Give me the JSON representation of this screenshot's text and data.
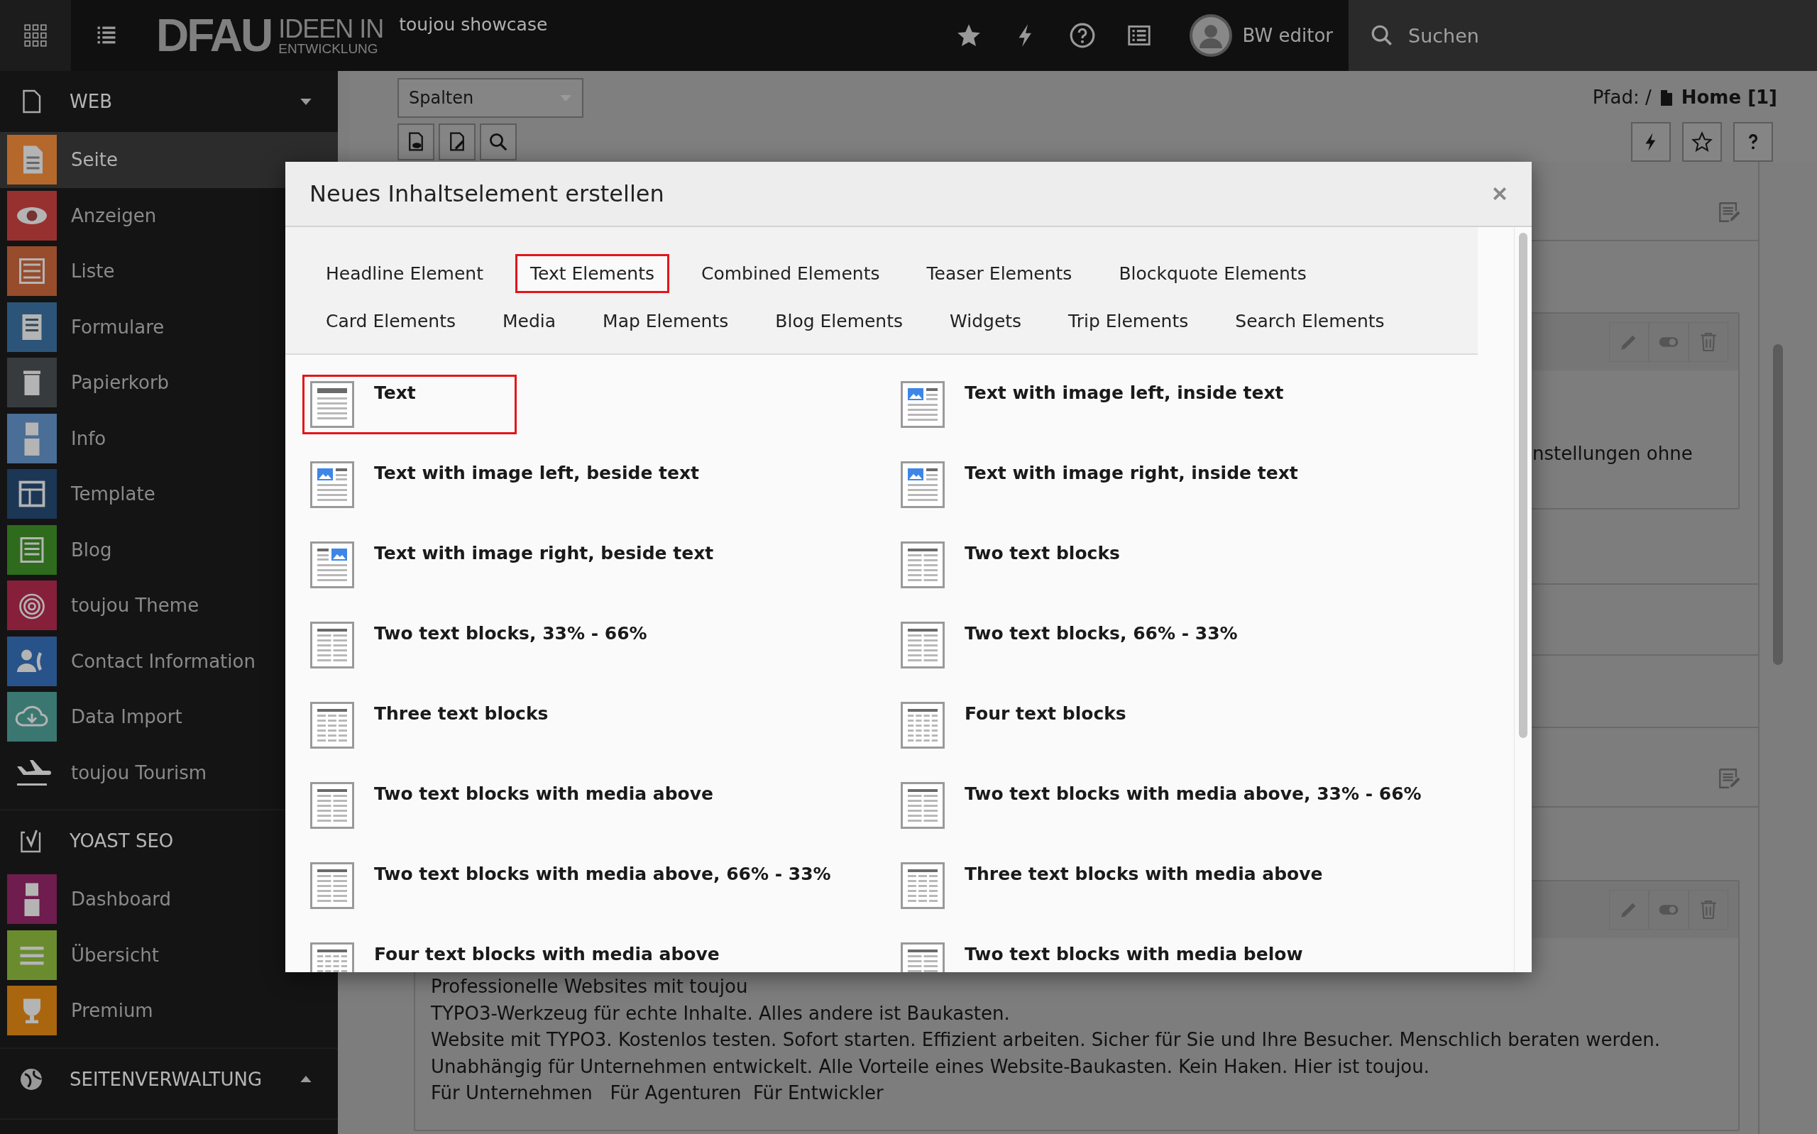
{
  "topbar": {
    "logo": {
      "mark": "DFAU",
      "line1": "IDEEN IN",
      "line2": "ENTWICKLUNG"
    },
    "site_name": "toujou showcase",
    "user": "BW editor",
    "search": {
      "placeholder": "Suchen"
    }
  },
  "sidebar": {
    "sections": [
      {
        "title": "WEB",
        "expanded": true,
        "items": [
          {
            "label": "Seite",
            "color": "#b5682c",
            "selected": true
          },
          {
            "label": "Anzeigen",
            "color": "#973130",
            "selected": false
          },
          {
            "label": "Liste",
            "color": "#974c2c",
            "selected": false
          },
          {
            "label": "Formulare",
            "color": "#2c5478",
            "selected": false
          },
          {
            "label": "Papierkorb",
            "color": "#383b3d",
            "selected": false
          },
          {
            "label": "Info",
            "color": "#4a6e96",
            "selected": false
          },
          {
            "label": "Template",
            "color": "#1c3756",
            "selected": false
          },
          {
            "label": "Blog",
            "color": "#2e6b1d",
            "selected": false
          },
          {
            "label": "toujou Theme",
            "color": "#86203a",
            "selected": false
          },
          {
            "label": "Contact Information",
            "color": "#27538a",
            "selected": false
          },
          {
            "label": "Data Import",
            "color": "#3b7771",
            "selected": false
          },
          {
            "label": "toujou Tourism",
            "selected": false
          }
        ]
      },
      {
        "title": "YOAST SEO",
        "items": [
          {
            "label": "Dashboard",
            "color": "#6f1c4e",
            "selected": false
          },
          {
            "label": "Übersicht",
            "color": "#6a8c2e",
            "selected": false
          },
          {
            "label": "Premium",
            "color": "#a9660f",
            "selected": false
          }
        ]
      },
      {
        "title": "SEITENVERWALTUNG",
        "expanded": false
      }
    ]
  },
  "docheader": {
    "view_select": {
      "value": "Spalten"
    },
    "path_label": "Pfad: /",
    "path_page": "Home [1]"
  },
  "content": {
    "partial_text": "nstellungen ohne",
    "lines": [
      "Professionelle Websites mit toujou",
      "TYPO3-Werkzeug für echte Inhalte. Alles andere ist Baukasten.",
      "Website mit TYPO3. Kostenlos testen. Sofort starten. Effizient arbeiten. Sicher für Sie und Ihre Besucher. Menschlich beraten werden.",
      "Unabhängig für Unternehmen entwickelt. Alle Vorteile eines Website-Baukasten. Kein Haken. Hier ist toujou.",
      "Für Unternehmen   Für Agenturen  Für Entwickler"
    ]
  },
  "modal": {
    "title": "Neues Inhaltselement erstellen",
    "tabs": [
      {
        "label": "Headline Element",
        "selected": false
      },
      {
        "label": "Text Elements",
        "selected": true
      },
      {
        "label": "Combined Elements",
        "selected": false
      },
      {
        "label": "Teaser Elements",
        "selected": false
      },
      {
        "label": "Blockquote Elements",
        "selected": false
      },
      {
        "label": "Card Elements",
        "selected": false
      },
      {
        "label": "Media",
        "selected": false
      },
      {
        "label": "Map Elements",
        "selected": false
      },
      {
        "label": "Blog Elements",
        "selected": false
      },
      {
        "label": "Widgets",
        "selected": false
      },
      {
        "label": "Trip Elements",
        "selected": false
      },
      {
        "label": "Search Elements",
        "selected": false
      }
    ],
    "elements": [
      {
        "title": "Text",
        "kind": "text",
        "selected": true
      },
      {
        "title": "Text with image left, inside text",
        "kind": "imageleft",
        "selected": false
      },
      {
        "title": "Text with image left, beside text",
        "kind": "imageleft",
        "selected": false
      },
      {
        "title": "Text with image right, inside text",
        "kind": "imageleft",
        "selected": false
      },
      {
        "title": "Text with image right, beside text",
        "kind": "imageright",
        "selected": false
      },
      {
        "title": "Two text blocks",
        "kind": "twocol",
        "selected": false
      },
      {
        "title": "Two text blocks, 33% - 66%",
        "kind": "twocol",
        "selected": false
      },
      {
        "title": "Two text blocks, 66% - 33%",
        "kind": "twocol",
        "selected": false
      },
      {
        "title": "Three text blocks",
        "kind": "threecol",
        "selected": false
      },
      {
        "title": "Four text blocks",
        "kind": "fourcol",
        "selected": false
      },
      {
        "title": "Two text blocks with media above",
        "kind": "twocol",
        "selected": false
      },
      {
        "title": "Two text blocks with media above, 33% - 66%",
        "kind": "twocol",
        "selected": false
      },
      {
        "title": "Two text blocks with media above, 66% - 33%",
        "kind": "twocol",
        "selected": false
      },
      {
        "title": "Three text blocks with media above",
        "kind": "threecol",
        "selected": false
      },
      {
        "title": "Four text blocks with media above",
        "kind": "fourcol",
        "selected": false
      },
      {
        "title": "Two text blocks with media below",
        "kind": "twocol",
        "selected": false
      }
    ]
  }
}
